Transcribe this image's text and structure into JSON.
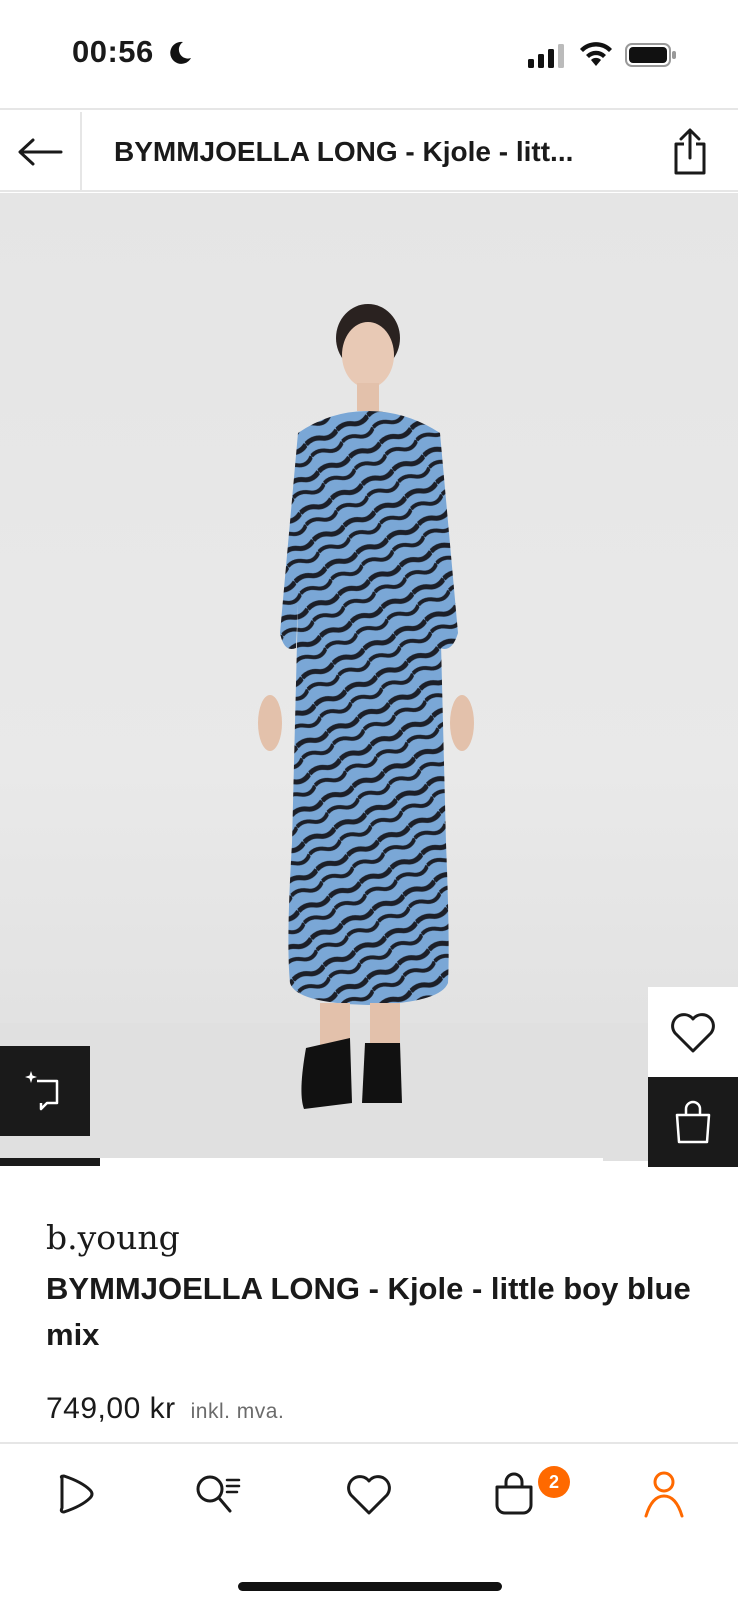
{
  "status_bar": {
    "time": "00:56",
    "icons": [
      "moon-icon",
      "cellular-signal-icon",
      "wifi-icon",
      "battery-icon"
    ]
  },
  "header": {
    "title": "BYMMJOELLA LONG - Kjole - litt...",
    "icons": [
      "arrow-left-icon",
      "share-icon"
    ]
  },
  "product": {
    "brand": "b.young",
    "name": "BYMMJOELLA LONG - Kjole - little boy blue mix",
    "price": "749,00 kr",
    "vat_note": "inkl. mva.",
    "image_icons": [
      "heart-icon",
      "shopping-bag-icon",
      "similar-items-icon"
    ],
    "image_count_indicator": 0.17
  },
  "bottom_nav": {
    "items": [
      "play-icon",
      "search-list-icon",
      "heart-icon",
      "bag-icon",
      "user-icon"
    ],
    "cart_badge": "2",
    "active_color": "#ff6900"
  }
}
